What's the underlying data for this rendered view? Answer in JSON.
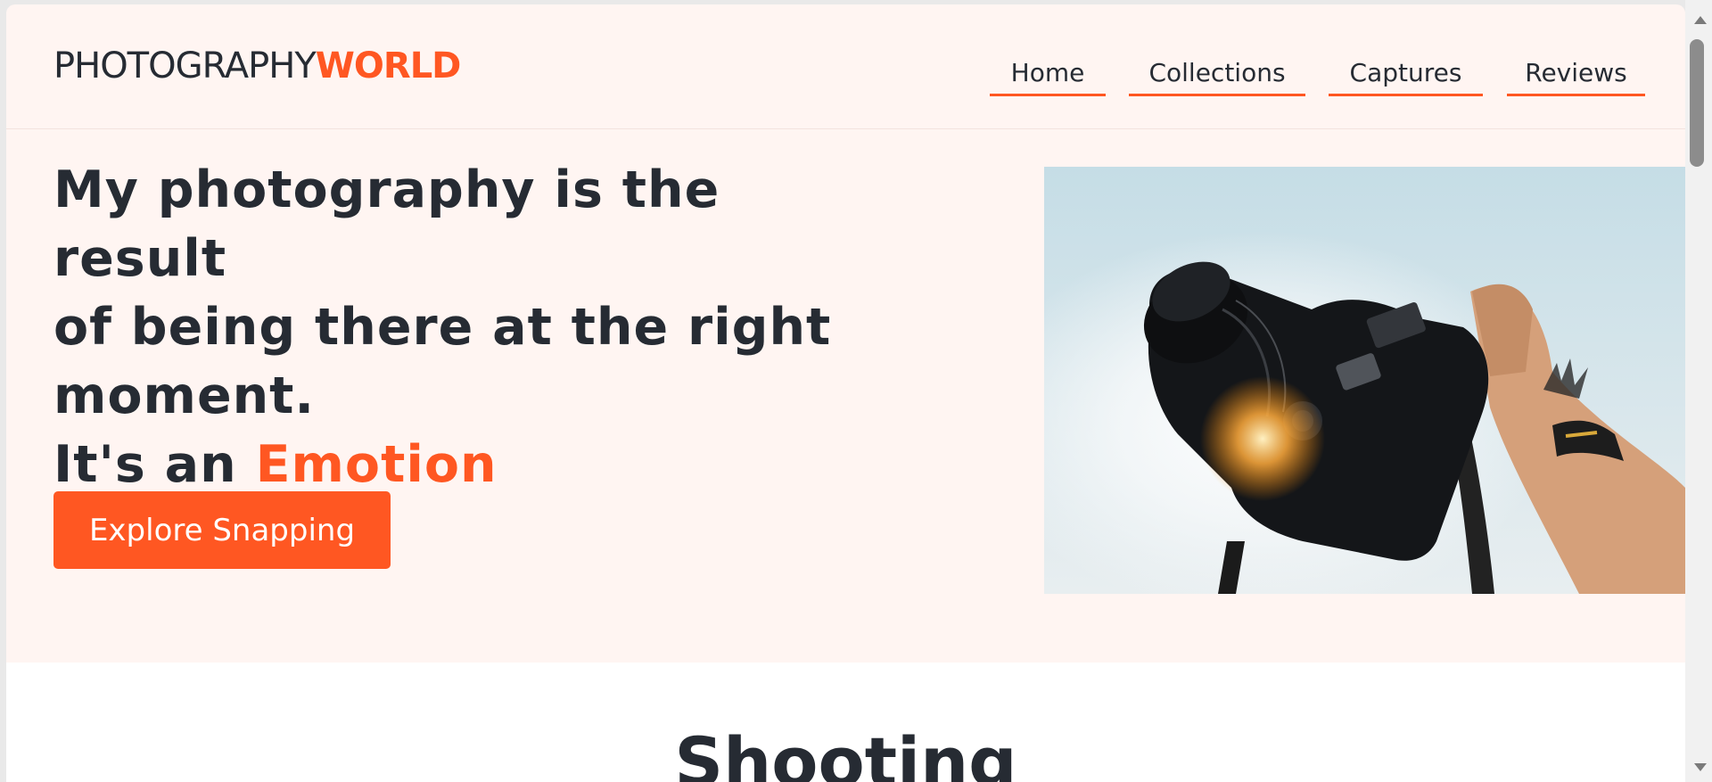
{
  "brand": {
    "part1": "PHOTOGRAPHY",
    "part2": "WORLD"
  },
  "nav": {
    "items": [
      {
        "label": "Home"
      },
      {
        "label": "Collections"
      },
      {
        "label": "Captures"
      },
      {
        "label": "Reviews"
      }
    ]
  },
  "hero": {
    "line1": "My photography is the result",
    "line2": "of being there at the right",
    "line3": "moment.",
    "line4_prefix": "It's an ",
    "line4_accent": "Emotion",
    "cta_label": "Explore Snapping",
    "image_alt": "camera-held-against-sky"
  },
  "section": {
    "title": "Shooting"
  },
  "colors": {
    "accent": "#ff5722",
    "text": "#262b33",
    "hero_bg": "#fff5f2"
  }
}
